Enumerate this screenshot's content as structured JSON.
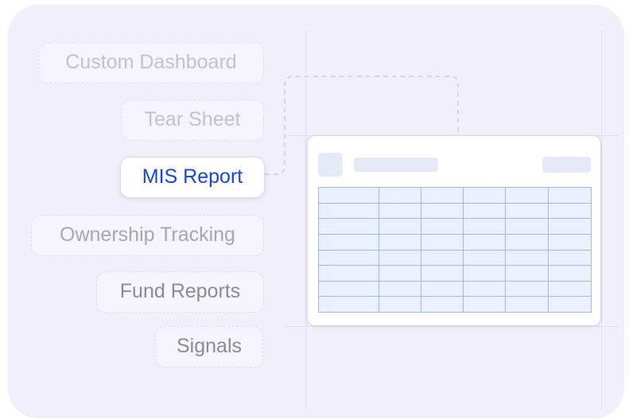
{
  "menu": {
    "items": [
      {
        "id": "custom-dashboard",
        "label": "Custom Dashboard",
        "state": "inactive"
      },
      {
        "id": "tear-sheet",
        "label": "Tear Sheet",
        "state": "inactive"
      },
      {
        "id": "mis-report",
        "label": "MIS Report",
        "state": "active"
      },
      {
        "id": "ownership-tracking",
        "label": "Ownership Tracking",
        "state": "inactive"
      },
      {
        "id": "fund-reports",
        "label": "Fund Reports",
        "state": "inactive"
      },
      {
        "id": "signals",
        "label": "Signals",
        "state": "inactive"
      }
    ]
  },
  "report_preview": {
    "columns": 6,
    "rows": 8
  },
  "colors": {
    "background": "#f1eff9",
    "accent": "#1747d6",
    "chip_text_muted": "#a7a6b4",
    "grid_fill": "#eaf0fd",
    "grid_line": "#a6b6e6",
    "connector": "#d6d3e2"
  }
}
